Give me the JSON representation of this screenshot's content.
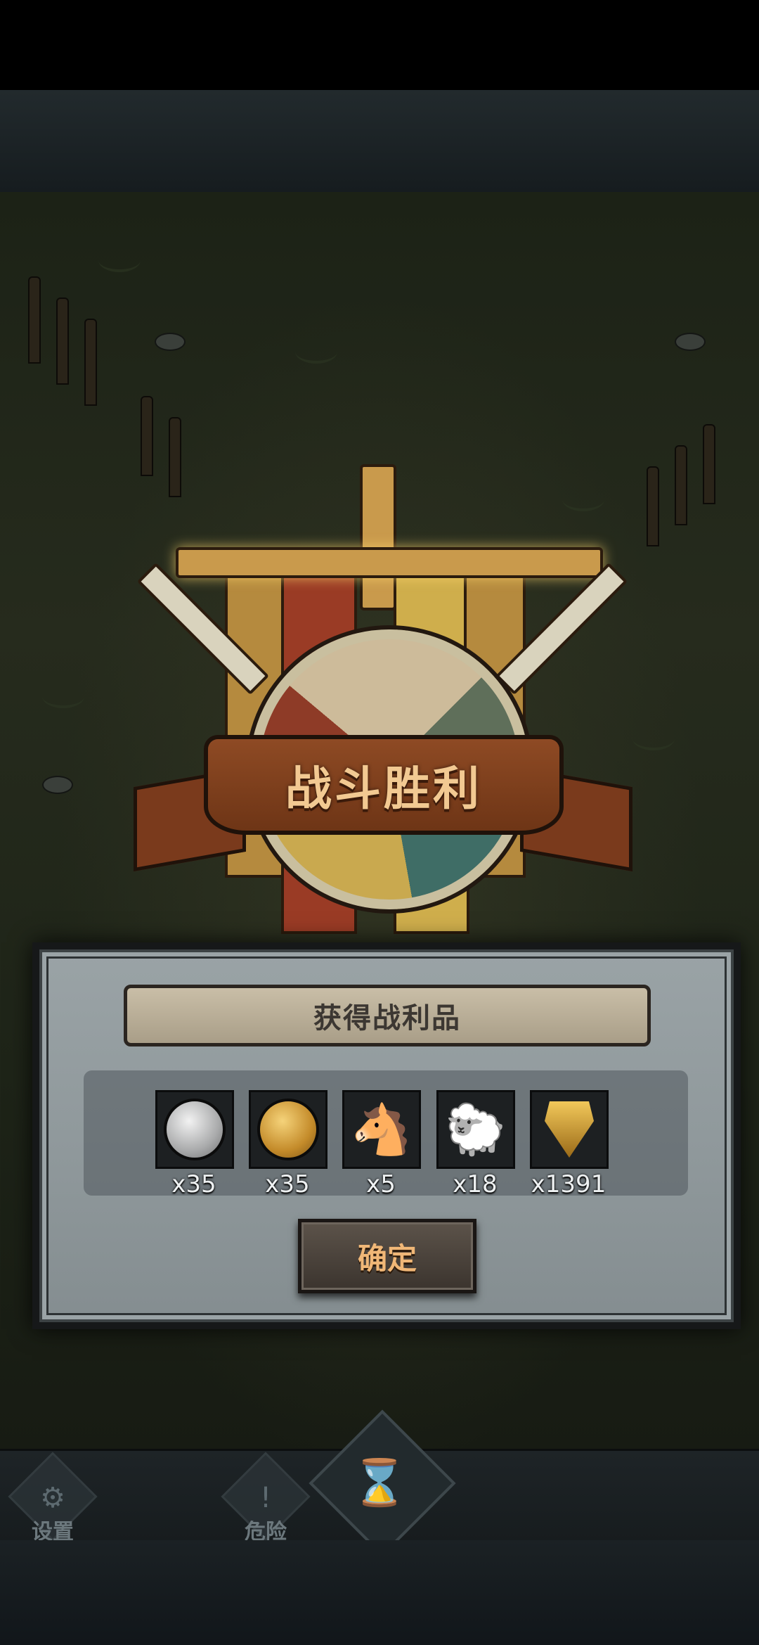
{
  "victory": {
    "title": "战斗胜利"
  },
  "reward_dialog": {
    "title": "获得战利品",
    "items": [
      {
        "icon": "silver-coin-icon",
        "count": "x35"
      },
      {
        "icon": "gold-coin-icon",
        "count": "x35"
      },
      {
        "icon": "horse-icon",
        "count": "x5"
      },
      {
        "icon": "sheep-icon",
        "count": "x18"
      },
      {
        "icon": "golden-crest-icon",
        "count": "x1391"
      }
    ],
    "confirm_label": "确定"
  },
  "hud": {
    "settings_label": "设置",
    "danger_label": "危险"
  },
  "colors": {
    "ribbon": "#7a3a1c",
    "ribbon_text": "#f2c992",
    "dialog": "#9aa3a6",
    "button_text": "#f0b777"
  }
}
